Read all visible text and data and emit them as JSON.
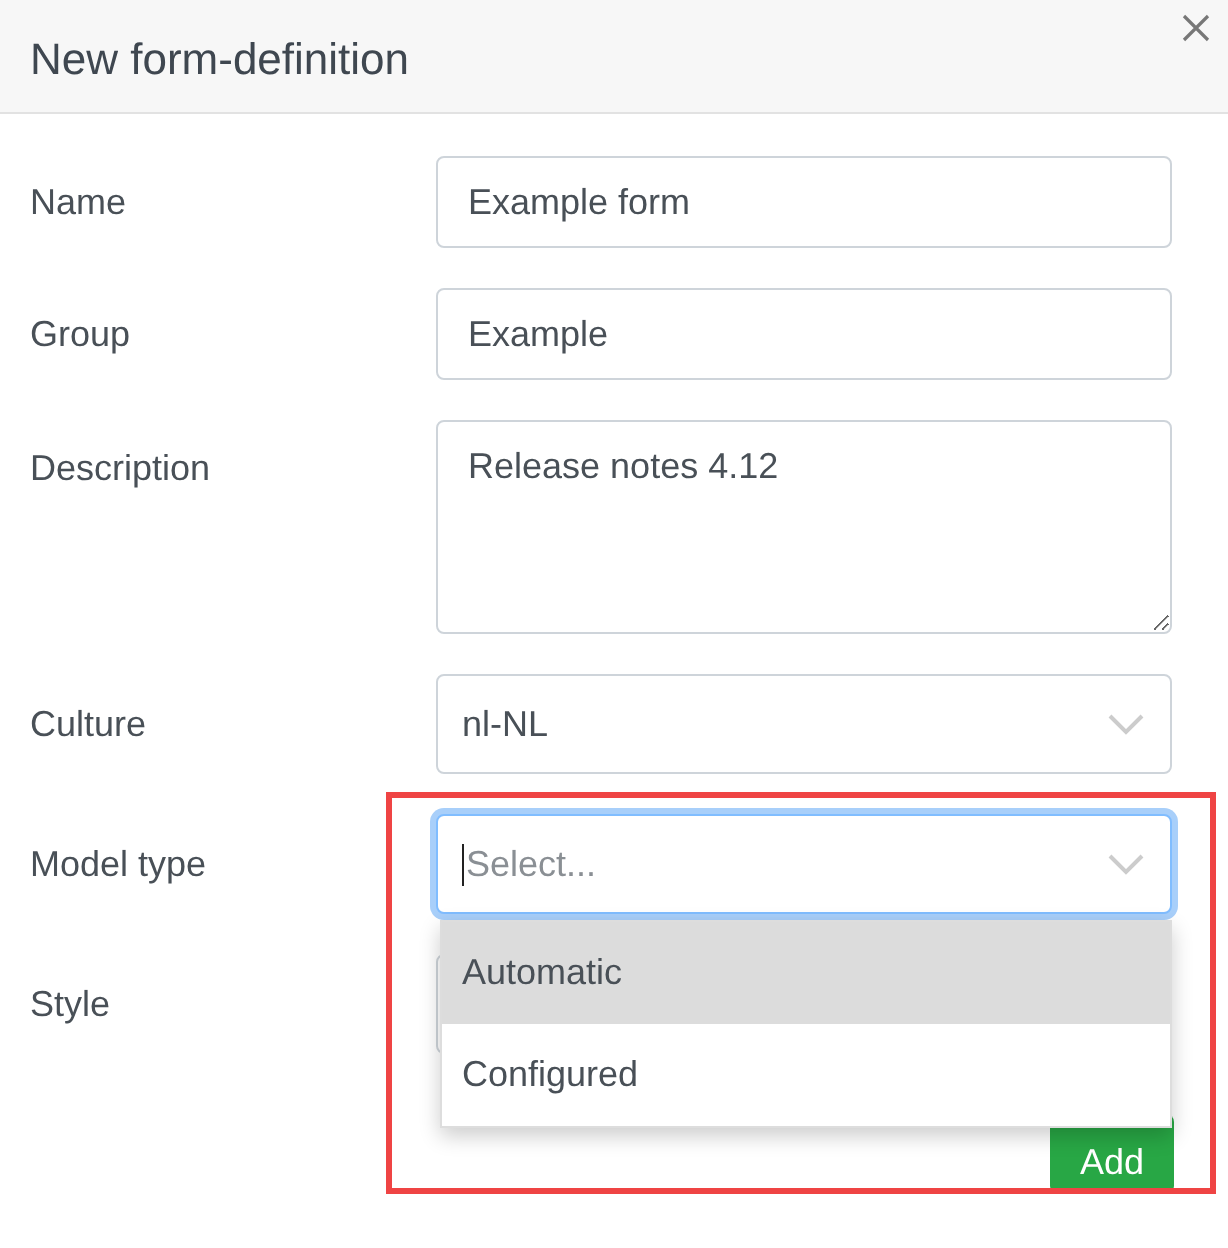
{
  "dialog": {
    "title": "New form-definition"
  },
  "fields": [
    {
      "label": "Name",
      "kind": "text",
      "value": "Example form"
    },
    {
      "label": "Group",
      "kind": "text",
      "value": "Example"
    },
    {
      "label": "Description",
      "kind": "textarea",
      "value": "Release notes 4.12"
    },
    {
      "label": "Culture",
      "kind": "select",
      "value": "nl-NL"
    },
    {
      "label": "Model type",
      "kind": "select",
      "placeholder": "Select...",
      "focused": true,
      "expanded": true,
      "options": [
        {
          "label": "Automatic",
          "selected": true
        },
        {
          "label": "Configured",
          "selected": false
        }
      ]
    },
    {
      "label": "Style",
      "kind": "select"
    }
  ],
  "buttons": [
    {
      "label": "Add"
    }
  ],
  "highlight": {
    "color": "#ef4444"
  }
}
